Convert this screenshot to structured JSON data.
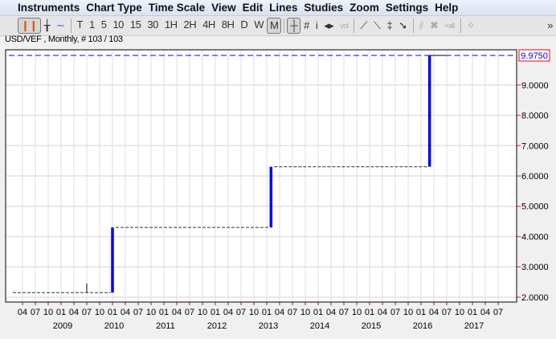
{
  "menu": [
    "Instruments",
    "Chart Type",
    "Time Scale",
    "View",
    "Edit",
    "Lines",
    "Studies",
    "Zoom",
    "Settings",
    "Help"
  ],
  "toolbar": {
    "timeframes": [
      "T",
      "1",
      "5",
      "10",
      "15",
      "30",
      "1H",
      "2H",
      "4H",
      "8H",
      "D",
      "W",
      "M"
    ],
    "selected": "M",
    "more": "»"
  },
  "info": "USD/VEF , Monthly, # 103 / 103",
  "colors": {
    "bar": "#0000ff",
    "last_price": "#0000ff",
    "label_border": "#ff0000",
    "grid": "#dddddd"
  },
  "chart_data": {
    "type": "line",
    "instrument": "USD/VEF",
    "timeframe": "Monthly",
    "last_price_label": "9.9750",
    "y_ticks": [
      "2.0000",
      "3.0000",
      "4.0000",
      "5.0000",
      "6.0000",
      "7.0000",
      "8.0000",
      "9.0000"
    ],
    "ylim": [
      1.84,
      10.16
    ],
    "x_tick_labels": [
      "04",
      "07",
      "10",
      "01",
      "04",
      "07",
      "10",
      "01",
      "04",
      "07",
      "10",
      "01",
      "04",
      "07",
      "10",
      "01",
      "04",
      "07",
      "10",
      "01",
      "04",
      "07",
      "10",
      "01",
      "04",
      "07",
      "10",
      "01",
      "04",
      "07",
      "10",
      "01",
      "04",
      "07",
      "10",
      "01",
      "04",
      "07"
    ],
    "years": [
      "2009",
      "2010",
      "2011",
      "2012",
      "2013",
      "2014",
      "2015",
      "2016",
      "2017"
    ],
    "steps": [
      {
        "from": "2008-01",
        "to": "2009-12",
        "value": 2.15
      },
      {
        "from": "2010-01",
        "to": "2013-01",
        "value": 4.3
      },
      {
        "from": "2013-02",
        "to": "2016-02",
        "value": 6.3
      },
      {
        "from": "2016-03",
        "to": "2017-09",
        "value": 9.975
      }
    ],
    "jumps": [
      {
        "month": "2010-01",
        "low": 2.15,
        "high": 4.3
      },
      {
        "month": "2013-02",
        "low": 4.3,
        "high": 6.3
      },
      {
        "month": "2016-03",
        "low": 6.3,
        "high": 9.975
      }
    ],
    "spike": {
      "month": "2009-07",
      "low": 2.15,
      "high": 2.45
    }
  }
}
